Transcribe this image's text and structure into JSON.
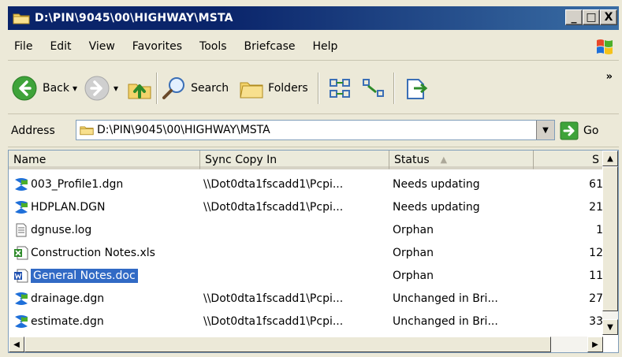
{
  "window": {
    "title": "D:\\PIN\\9045\\00\\HIGHWAY\\MSTA",
    "min_label": "_",
    "max_label": "□",
    "close_label": "X"
  },
  "menubar": {
    "items": [
      {
        "label": "File"
      },
      {
        "label": "Edit"
      },
      {
        "label": "View"
      },
      {
        "label": "Favorites"
      },
      {
        "label": "Tools"
      },
      {
        "label": "Briefcase"
      },
      {
        "label": "Help"
      }
    ]
  },
  "toolbar": {
    "back_label": "Back",
    "search_label": "Search",
    "folders_label": "Folders",
    "overflow_label": "»"
  },
  "address": {
    "label": "Address",
    "value": "D:\\PIN\\9045\\00\\HIGHWAY\\MSTA",
    "go_label": "Go"
  },
  "list": {
    "columns": [
      {
        "label": "Name"
      },
      {
        "label": "Sync Copy In"
      },
      {
        "label": "Status",
        "sort": "ascending"
      },
      {
        "label": "S"
      }
    ],
    "rows": [
      {
        "name": "003_Profile1.dgn",
        "sync": "\\\\Dot0dta1fscadd1\\Pcpi...",
        "status": "Needs updating",
        "size": "61",
        "icon": "dgn-file-icon"
      },
      {
        "name": "HDPLAN.DGN",
        "sync": "\\\\Dot0dta1fscadd1\\Pcpi...",
        "status": "Needs updating",
        "size": "21",
        "icon": "dgn-file-icon"
      },
      {
        "name": "dgnuse.log",
        "sync": "",
        "status": "Orphan",
        "size": "1",
        "icon": "text-file-icon"
      },
      {
        "name": "Construction Notes.xls",
        "sync": "",
        "status": "Orphan",
        "size": "12",
        "icon": "excel-file-icon"
      },
      {
        "name": "General Notes.doc",
        "sync": "",
        "status": "Orphan",
        "size": "11",
        "icon": "word-file-icon",
        "selected": true
      },
      {
        "name": "drainage.dgn",
        "sync": "\\\\Dot0dta1fscadd1\\Pcpi...",
        "status": "Unchanged in Bri...",
        "size": "27",
        "icon": "dgn-file-icon"
      },
      {
        "name": "estimate.dgn",
        "sync": "\\\\Dot0dta1fscadd1\\Pcpi...",
        "status": "Unchanged in Bri...",
        "size": "33",
        "icon": "dgn-file-icon"
      }
    ]
  },
  "colors": {
    "title_start": "#0a246a",
    "title_end": "#3a6ea5",
    "selection": "#316ac5",
    "chrome": "#ece9d8"
  }
}
